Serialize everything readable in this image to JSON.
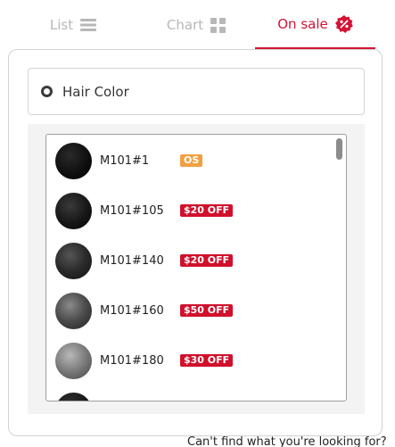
{
  "tabs": [
    {
      "label": "List",
      "icon": "list-icon"
    },
    {
      "label": "Chart",
      "icon": "grid-icon"
    },
    {
      "label": "On sale",
      "icon": "discount-badge-icon",
      "active": true
    }
  ],
  "colors": {
    "accent": "#d31335",
    "os_badge": "#f0a044",
    "off_badge": "#d0102c"
  },
  "category": {
    "label": "Hair Color"
  },
  "items": [
    {
      "name": "M101#1",
      "badge": "OS",
      "badge_type": "os"
    },
    {
      "name": "M101#105",
      "badge": "$20 OFF",
      "badge_type": "off"
    },
    {
      "name": "M101#140",
      "badge": "$20 OFF",
      "badge_type": "off"
    },
    {
      "name": "M101#160",
      "badge": "$50 OFF",
      "badge_type": "off"
    },
    {
      "name": "M101#180",
      "badge": "$30 OFF",
      "badge_type": "off"
    }
  ],
  "footer": {
    "text": "Can't find what you're looking for?"
  }
}
